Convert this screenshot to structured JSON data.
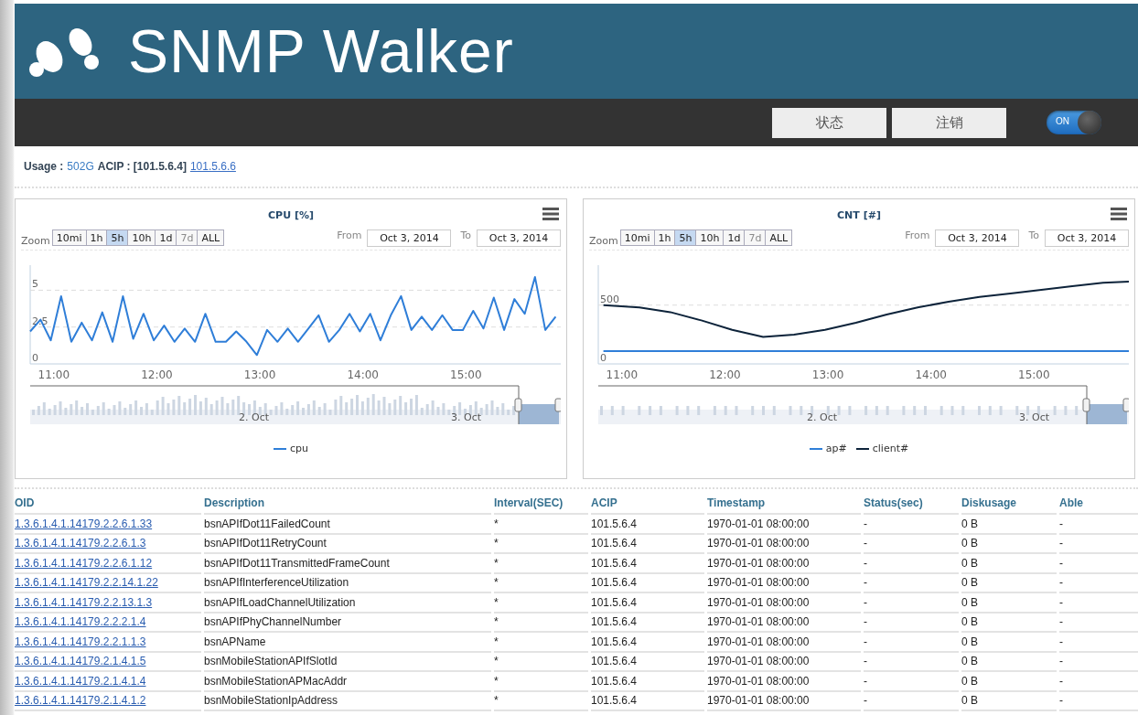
{
  "header": {
    "title": "SNMP Walker"
  },
  "nav": {
    "buttons": [
      "状态",
      "注销"
    ],
    "toggle": {
      "label": "ON",
      "on": true
    }
  },
  "info": {
    "usage_label": "Usage :",
    "usage_value": "502G",
    "acip_label": "ACIP : [101.5.6.4]",
    "acip_link": "101.5.6.6"
  },
  "charts": [
    {
      "zoom_label": "Zoom",
      "ranges": [
        {
          "label": "10mi",
          "selected": false,
          "disabled": false
        },
        {
          "label": "1h",
          "selected": false,
          "disabled": false
        },
        {
          "label": "5h",
          "selected": true,
          "disabled": false
        },
        {
          "label": "10h",
          "selected": false,
          "disabled": false
        },
        {
          "label": "1d",
          "selected": false,
          "disabled": false
        },
        {
          "label": "7d",
          "selected": false,
          "disabled": true
        },
        {
          "label": "ALL",
          "selected": false,
          "disabled": false
        }
      ],
      "from_label": "From",
      "from_value": "Oct 3, 2014",
      "to_label": "To",
      "to_value": "Oct 3, 2014",
      "navigator": {
        "labels": [
          "2. Oct",
          "3. Oct"
        ],
        "kind": "bars"
      },
      "chart_data": {
        "type": "line",
        "title": "CPU [%]",
        "x": [
          10.8,
          10.9,
          11.0,
          11.1,
          11.2,
          11.3,
          11.4,
          11.5,
          11.6,
          11.7,
          11.8,
          11.9,
          12.0,
          12.1,
          12.2,
          12.3,
          12.4,
          12.5,
          12.6,
          12.7,
          12.8,
          12.9,
          13.0,
          13.1,
          13.2,
          13.3,
          13.4,
          13.5,
          13.6,
          13.7,
          13.8,
          13.9,
          14.0,
          14.1,
          14.2,
          14.3,
          14.4,
          14.5,
          14.6,
          14.7,
          14.8,
          14.9,
          15.0,
          15.1,
          15.2,
          15.3,
          15.4,
          15.5,
          15.6,
          15.7,
          15.8,
          15.9
        ],
        "series": [
          {
            "name": "cpu",
            "color": "#2f7ed8",
            "values": [
              2.2,
              3.0,
              1.6,
              4.6,
              1.5,
              2.8,
              1.6,
              3.5,
              1.5,
              4.6,
              1.7,
              3.4,
              1.6,
              2.6,
              1.5,
              2.4,
              1.5,
              3.4,
              1.5,
              1.5,
              2.2,
              1.5,
              0.6,
              2.3,
              1.5,
              2.4,
              1.5,
              2.4,
              3.3,
              1.5,
              2.3,
              3.4,
              2.2,
              3.4,
              1.6,
              3.3,
              4.6,
              2.3,
              3.2,
              2.3,
              3.3,
              2.3,
              2.3,
              3.6,
              2.4,
              4.5,
              2.3,
              4.4,
              3.4,
              5.9,
              2.3,
              3.2
            ]
          }
        ],
        "xlim": [
          10.8,
          15.95
        ],
        "ylim": [
          0,
          6.7
        ],
        "yticks": [
          0,
          {
            "value": 2.5,
            "label": "2.5"
          },
          5
        ],
        "xticks": [
          {
            "value": 11,
            "label": "11:00"
          },
          {
            "value": 12,
            "label": "12:00"
          },
          {
            "value": 13,
            "label": "13:00"
          },
          {
            "value": 14,
            "label": "14:00"
          },
          {
            "value": 15,
            "label": "15:00"
          }
        ]
      }
    },
    {
      "zoom_label": "Zoom",
      "ranges": [
        {
          "label": "10mi",
          "selected": false,
          "disabled": false
        },
        {
          "label": "1h",
          "selected": false,
          "disabled": false
        },
        {
          "label": "5h",
          "selected": true,
          "disabled": false
        },
        {
          "label": "10h",
          "selected": false,
          "disabled": false
        },
        {
          "label": "1d",
          "selected": false,
          "disabled": false
        },
        {
          "label": "7d",
          "selected": false,
          "disabled": true
        },
        {
          "label": "ALL",
          "selected": false,
          "disabled": false
        }
      ],
      "from_label": "From",
      "from_value": "Oct 3, 2014",
      "to_label": "To",
      "to_value": "Oct 3, 2014",
      "navigator": {
        "labels": [
          "2. Oct",
          "3. Oct"
        ],
        "kind": "ticks"
      },
      "chart_data": {
        "type": "line",
        "title": "CNT [#]",
        "x": [
          10.85,
          11.2,
          11.5,
          11.8,
          12.1,
          12.4,
          12.7,
          13.0,
          13.3,
          13.6,
          13.9,
          14.2,
          14.5,
          14.8,
          15.1,
          15.4,
          15.7,
          15.95
        ],
        "series": [
          {
            "name": "ap#",
            "color": "#2f7ed8",
            "values": [
              110,
              110,
              110,
              110,
              110,
              110,
              110,
              110,
              110,
              110,
              110,
              110,
              110,
              110,
              110,
              110,
              110,
              110
            ]
          },
          {
            "name": "client#",
            "color": "#0d233a",
            "values": [
              500,
              480,
              440,
              370,
              290,
              230,
              250,
              290,
              350,
              420,
              480,
              530,
              570,
              600,
              630,
              660,
              690,
              700
            ]
          }
        ],
        "xlim": [
          10.8,
          15.95
        ],
        "ylim": [
          0,
          840
        ],
        "yticks": [
          0,
          500
        ],
        "xticks": [
          {
            "value": 11,
            "label": "11:00"
          },
          {
            "value": 12,
            "label": "12:00"
          },
          {
            "value": 13,
            "label": "13:00"
          },
          {
            "value": 14,
            "label": "14:00"
          },
          {
            "value": 15,
            "label": "15:00"
          }
        ]
      }
    }
  ],
  "table": {
    "columns": [
      "OID",
      "Description",
      "Interval(SEC)",
      "ACIP",
      "Timestamp",
      "Status(sec)",
      "Diskusage",
      "Able"
    ],
    "rows": [
      [
        "1.3.6.1.4.1.14179.2.2.6.1.33",
        "bsnAPIfDot11FailedCount",
        "*",
        "101.5.6.4",
        "1970-01-01 08:00:00",
        "-",
        "0 B",
        "-"
      ],
      [
        "1.3.6.1.4.1.14179.2.2.6.1.3",
        "bsnAPIfDot11RetryCount",
        "*",
        "101.5.6.4",
        "1970-01-01 08:00:00",
        "-",
        "0 B",
        "-"
      ],
      [
        "1.3.6.1.4.1.14179.2.2.6.1.12",
        "bsnAPIfDot11TransmittedFrameCount",
        "*",
        "101.5.6.4",
        "1970-01-01 08:00:00",
        "-",
        "0 B",
        "-"
      ],
      [
        "1.3.6.1.4.1.14179.2.2.14.1.22",
        "bsnAPIfInterferenceUtilization",
        "*",
        "101.5.6.4",
        "1970-01-01 08:00:00",
        "-",
        "0 B",
        "-"
      ],
      [
        "1.3.6.1.4.1.14179.2.2.13.1.3",
        "bsnAPIfLoadChannelUtilization",
        "*",
        "101.5.6.4",
        "1970-01-01 08:00:00",
        "-",
        "0 B",
        "-"
      ],
      [
        "1.3.6.1.4.1.14179.2.2.2.1.4",
        "bsnAPIfPhyChannelNumber",
        "*",
        "101.5.6.4",
        "1970-01-01 08:00:00",
        "-",
        "0 B",
        "-"
      ],
      [
        "1.3.6.1.4.1.14179.2.2.1.1.3",
        "bsnAPName",
        "*",
        "101.5.6.4",
        "1970-01-01 08:00:00",
        "-",
        "0 B",
        "-"
      ],
      [
        "1.3.6.1.4.1.14179.2.1.4.1.5",
        "bsnMobileStationAPIfSlotId",
        "*",
        "101.5.6.4",
        "1970-01-01 08:00:00",
        "-",
        "0 B",
        "-"
      ],
      [
        "1.3.6.1.4.1.14179.2.1.4.1.4",
        "bsnMobileStationAPMacAddr",
        "*",
        "101.5.6.4",
        "1970-01-01 08:00:00",
        "-",
        "0 B",
        "-"
      ],
      [
        "1.3.6.1.4.1.14179.2.1.4.1.2",
        "bsnMobileStationIpAddress",
        "*",
        "101.5.6.4",
        "1970-01-01 08:00:00",
        "-",
        "0 B",
        "-"
      ]
    ]
  }
}
